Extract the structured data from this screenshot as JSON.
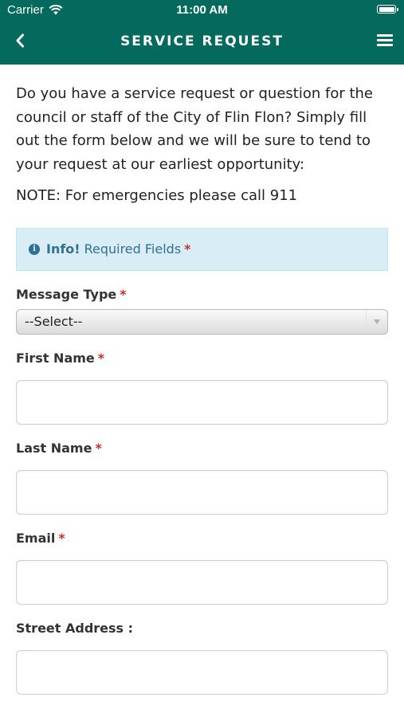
{
  "status_bar": {
    "carrier": "Carrier",
    "time": "11:00 AM"
  },
  "nav": {
    "title": "SERVICE REQUEST"
  },
  "intro": {
    "text": "Do you have a service request or question for the council or staff of the City of Flin Flon? Simply fill out the form below and we will be sure to tend to your request at our earliest opportunity:",
    "note": "NOTE: For emergencies please call 911"
  },
  "info_alert": {
    "strong": "Info!",
    "text": "Required Fields",
    "required_mark": "*"
  },
  "form": {
    "message_type": {
      "label": "Message Type",
      "required_mark": "*",
      "selected": "--Select--"
    },
    "first_name": {
      "label": "First Name",
      "required_mark": "*",
      "value": ""
    },
    "last_name": {
      "label": "Last Name",
      "required_mark": "*",
      "value": ""
    },
    "email": {
      "label": "Email",
      "required_mark": "*",
      "value": ""
    },
    "street_address": {
      "label": "Street Address :",
      "value": ""
    }
  },
  "colors": {
    "header": "#036a5d",
    "info_bg": "#d9edf7",
    "info_text": "#31708f",
    "required": "#c9302c"
  },
  "icons": {
    "back": "chevron-left-icon",
    "menu": "hamburger-menu-icon",
    "info": "info-circle-icon",
    "wifi": "wifi-icon",
    "battery": "battery-icon"
  }
}
